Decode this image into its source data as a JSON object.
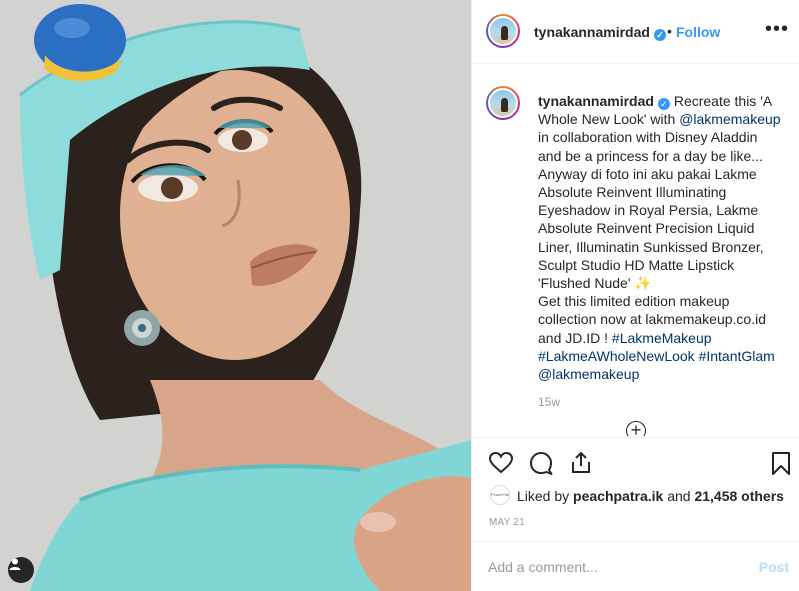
{
  "header": {
    "username": "tynakannamirdad",
    "separator": "•",
    "follow_label": "Follow",
    "more_label": "•••"
  },
  "caption": {
    "username": "tynakannamirdad",
    "text_before": "Recreate this 'A Whole New Look' with ",
    "mention_1": "@lakmemakeup",
    "text_middle": " in collaboration with Disney Aladdin and be a princess for a day be like...\nAnyway di foto ini aku pakai Lakme Absolute Reinvent Illuminating Eyeshadow in Royal Persia, Lakme Absolute Reinvent Precision Liquid Liner, Illuminatin Sunkissed Bronzer, Sculpt Studio HD Matte Lipstick 'Flushed Nude' ✨\nGet this limited edition makeup collection now at lakmemakeup.co.id and JD.ID ! ",
    "hashtag_1": "#LakmeMakeup",
    "hashtag_2": "#LakmeAWholeNewLook",
    "hashtag_3": "#IntantGlam",
    "mention_2": "@lakmemakeup",
    "time": "15w",
    "load_more_label": "+"
  },
  "actions": {
    "like_icon": "heart-icon",
    "comment_icon": "comment-icon",
    "share_icon": "share-icon",
    "save_icon": "bookmark-icon"
  },
  "likes": {
    "avatar_text": "PeachPatra",
    "prefix": "Liked by ",
    "user": "peachpatra.ik",
    "middle": " and ",
    "count": "21,458 others"
  },
  "date": "MAY 21",
  "comment": {
    "placeholder": "Add a comment...",
    "post_label": "Post"
  },
  "colors": {
    "link": "#3897f0",
    "hashtag": "#003569",
    "post_disabled": "#b2dffc",
    "genie_teal": "#7fd6d4"
  }
}
